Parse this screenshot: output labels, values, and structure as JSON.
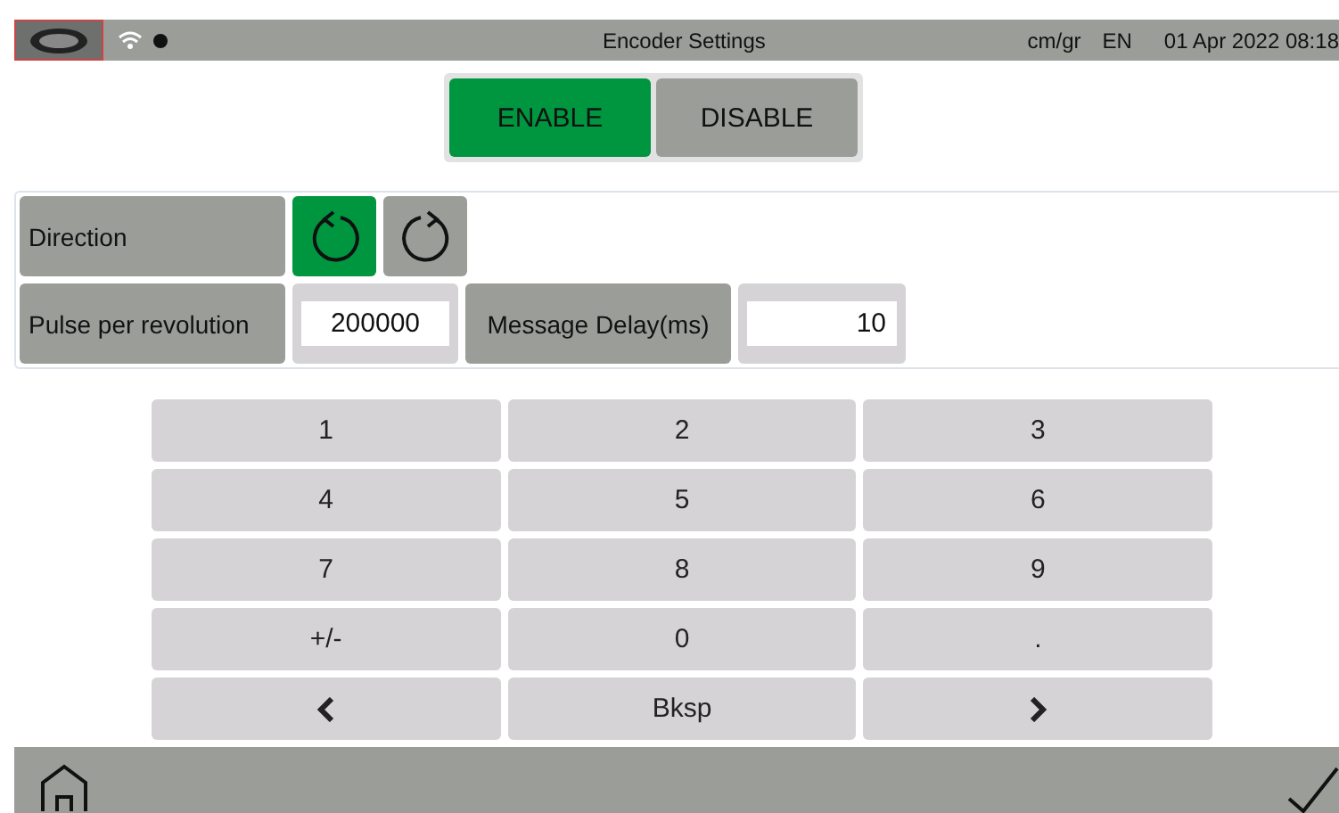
{
  "status_bar": {
    "title": "Encoder Settings",
    "units": "cm/gr",
    "language": "EN",
    "datetime": "01 Apr 2022 08:18"
  },
  "mode_buttons": [
    {
      "label": "ENABLE",
      "selected": true
    },
    {
      "label": "DISABLE",
      "selected": false
    }
  ],
  "direction": {
    "label": "Direction",
    "options": [
      {
        "kind": "ccw",
        "selected": true
      },
      {
        "kind": "cw",
        "selected": false
      }
    ]
  },
  "pulse": {
    "label": "Pulse per revolution",
    "value": "200000"
  },
  "delay": {
    "label": "Message Delay(ms)",
    "value": "10"
  },
  "keypad": [
    {
      "kind": "text",
      "label": "1"
    },
    {
      "kind": "text",
      "label": "2"
    },
    {
      "kind": "text",
      "label": "3"
    },
    {
      "kind": "text",
      "label": "4"
    },
    {
      "kind": "text",
      "label": "5"
    },
    {
      "kind": "text",
      "label": "6"
    },
    {
      "kind": "text",
      "label": "7"
    },
    {
      "kind": "text",
      "label": "8"
    },
    {
      "kind": "text",
      "label": "9"
    },
    {
      "kind": "text",
      "label": "+/-"
    },
    {
      "kind": "text",
      "label": "0"
    },
    {
      "kind": "text",
      "label": "."
    },
    {
      "kind": "left"
    },
    {
      "kind": "text",
      "label": "Bksp"
    },
    {
      "kind": "right"
    }
  ]
}
